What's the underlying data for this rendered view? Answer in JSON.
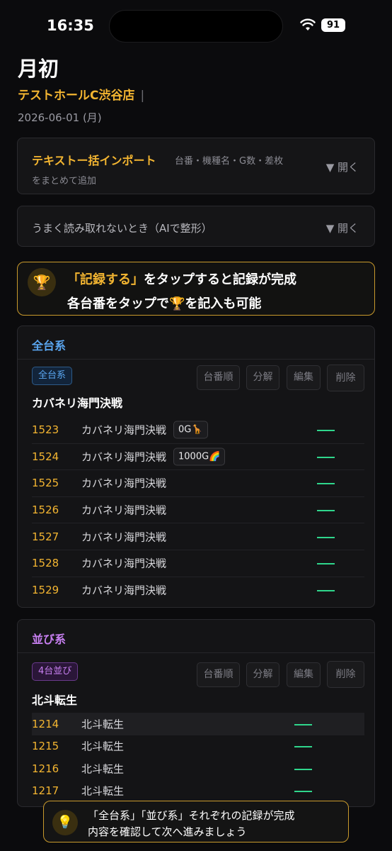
{
  "status": {
    "time": "16:35",
    "battery": "91"
  },
  "page": {
    "title": "月初",
    "store": "テストホールC渋谷店",
    "store_sep": "|",
    "date": "2026-06-01 (月)"
  },
  "import": {
    "title": "テキストー括インポート",
    "desc1": "台番・機種名・G数・差枚",
    "desc2": "をまとめて追加",
    "toggle": "▼ 開く"
  },
  "ai": {
    "title": "うまく読み取れないとき（AIで整形）",
    "toggle": "▼ 開く"
  },
  "banner": {
    "line1_highlight": "「記録する」",
    "line1_rest": "をタップすると記録が完成",
    "line2_before": "各台番をタップで",
    "line2_icon": "🏆",
    "line2_after": "を記入も可能"
  },
  "buttons": {
    "sort": "台番順",
    "split": "分解",
    "edit": "編集",
    "delete": "削除"
  },
  "group1": {
    "title": "全台系",
    "tag": "全台系",
    "machine": "カバネリ海門決戦",
    "rows": [
      {
        "num": "1523",
        "name": "カバネリ海門決戦",
        "chip": "0G🦒"
      },
      {
        "num": "1524",
        "name": "カバネリ海門決戦",
        "chip": "1000G🌈"
      },
      {
        "num": "1525",
        "name": "カバネリ海門決戦",
        "chip": ""
      },
      {
        "num": "1526",
        "name": "カバネリ海門決戦",
        "chip": ""
      },
      {
        "num": "1527",
        "name": "カバネリ海門決戦",
        "chip": ""
      },
      {
        "num": "1528",
        "name": "カバネリ海門決戦",
        "chip": ""
      },
      {
        "num": "1529",
        "name": "カバネリ海門決戦",
        "chip": ""
      }
    ]
  },
  "group2": {
    "title": "並び系",
    "tag": "4台並び",
    "machine": "北斗転生",
    "rows": [
      {
        "num": "1214",
        "name": "北斗転生"
      },
      {
        "num": "1215",
        "name": "北斗転生"
      },
      {
        "num": "1216",
        "name": "北斗転生"
      },
      {
        "num": "1217",
        "name": "北斗転生"
      }
    ]
  },
  "toast": {
    "line1": "「全台系」「並び系」それぞれの記録が完成",
    "line2": "内容を確認して次へ進みましょう"
  },
  "colors": {
    "accent": "#f3b531",
    "blue": "#5aa6f0",
    "purple": "#c77ff0",
    "green": "#2fd68c"
  }
}
